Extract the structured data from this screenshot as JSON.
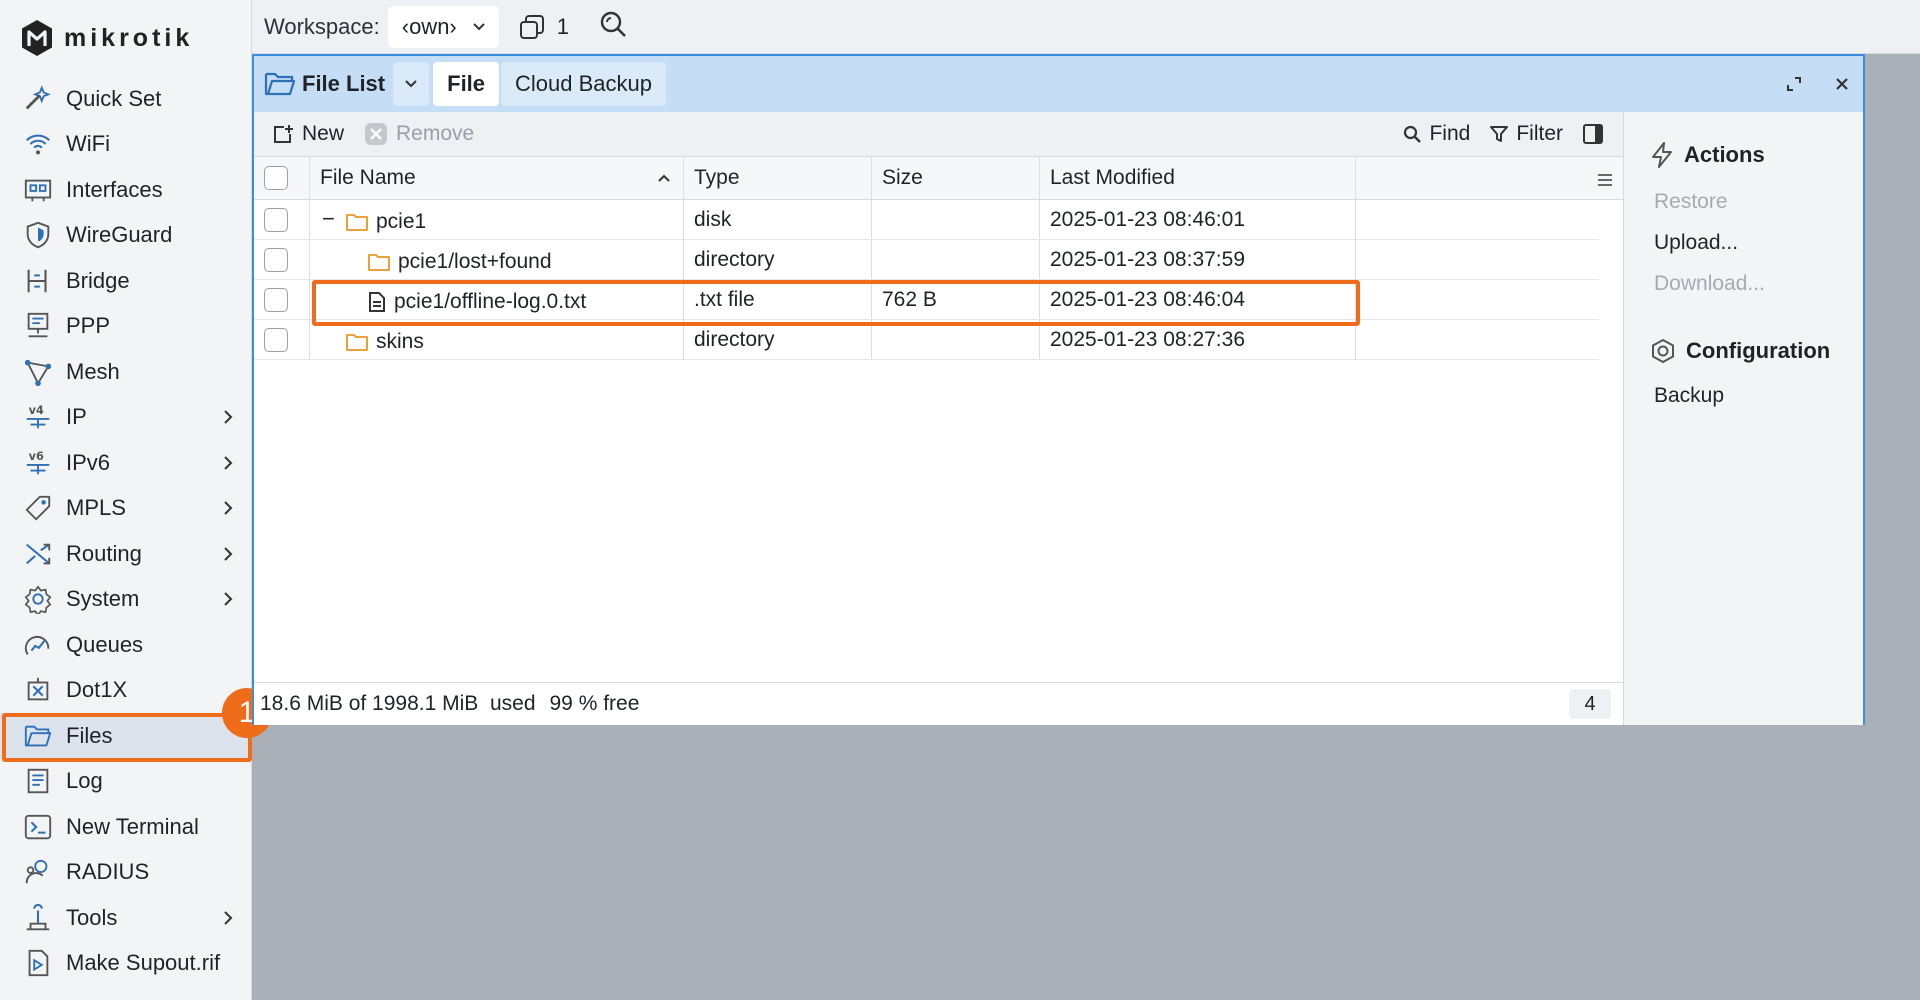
{
  "brand": {
    "name": "MikroTik"
  },
  "sidebar": {
    "items": [
      {
        "label": "Quick Set",
        "icon": "quick-set-icon",
        "has_children": false
      },
      {
        "label": "WiFi",
        "icon": "wifi-icon",
        "has_children": false
      },
      {
        "label": "Interfaces",
        "icon": "interfaces-icon",
        "has_children": false
      },
      {
        "label": "WireGuard",
        "icon": "wireguard-icon",
        "has_children": false
      },
      {
        "label": "Bridge",
        "icon": "bridge-icon",
        "has_children": false
      },
      {
        "label": "PPP",
        "icon": "ppp-icon",
        "has_children": false
      },
      {
        "label": "Mesh",
        "icon": "mesh-icon",
        "has_children": false
      },
      {
        "label": "IP",
        "icon": "ip-icon",
        "has_children": true
      },
      {
        "label": "IPv6",
        "icon": "ipv6-icon",
        "has_children": true
      },
      {
        "label": "MPLS",
        "icon": "mpls-icon",
        "has_children": true
      },
      {
        "label": "Routing",
        "icon": "routing-icon",
        "has_children": true
      },
      {
        "label": "System",
        "icon": "system-icon",
        "has_children": true
      },
      {
        "label": "Queues",
        "icon": "queues-icon",
        "has_children": false
      },
      {
        "label": "Dot1X",
        "icon": "dot1x-icon",
        "has_children": false
      },
      {
        "label": "Files",
        "icon": "files-icon",
        "has_children": false,
        "active": true
      },
      {
        "label": "Log",
        "icon": "log-icon",
        "has_children": false
      },
      {
        "label": "New Terminal",
        "icon": "terminal-icon",
        "has_children": false
      },
      {
        "label": "RADIUS",
        "icon": "radius-icon",
        "has_children": false
      },
      {
        "label": "Tools",
        "icon": "tools-icon",
        "has_children": true
      },
      {
        "label": "Make Supout.rif",
        "icon": "supout-icon",
        "has_children": false
      }
    ],
    "step_badge": "1"
  },
  "topbar": {
    "workspace_label": "Workspace:",
    "workspace_value": "‹own›",
    "window_count": "1"
  },
  "window": {
    "title": "File List",
    "tabs": [
      "File",
      "Cloud Backup"
    ],
    "active_tab": "File",
    "toolbar": {
      "new_label": "New",
      "remove_label": "Remove",
      "find_label": "Find",
      "filter_label": "Filter"
    },
    "columns": [
      "File Name",
      "Type",
      "Size",
      "Last Modified"
    ],
    "rows": [
      {
        "name": "pcie1",
        "type": "disk",
        "size": "",
        "modified": "2025-01-23 08:46:01",
        "kind": "folder",
        "indent": 0,
        "expander": "−"
      },
      {
        "name": "pcie1/lost+found",
        "type": "directory",
        "size": "",
        "modified": "2025-01-23 08:37:59",
        "kind": "folder",
        "indent": 1,
        "expander": ""
      },
      {
        "name": "pcie1/offline-log.0.txt",
        "type": ".txt file",
        "size": "762 B",
        "modified": "2025-01-23 08:46:04",
        "kind": "file",
        "indent": 1,
        "expander": ""
      },
      {
        "name": "skins",
        "type": "directory",
        "size": "",
        "modified": "2025-01-23 08:27:36",
        "kind": "folder",
        "indent": 0,
        "expander": ""
      }
    ],
    "status": {
      "usage_text": "18.6 MiB of 1998.1 MiB  used",
      "free_text": "99 % free",
      "count": "4"
    },
    "side_panel": {
      "actions_title": "Actions",
      "actions": [
        {
          "label": "Restore",
          "enabled": false
        },
        {
          "label": "Upload...",
          "enabled": true
        },
        {
          "label": "Download...",
          "enabled": false
        }
      ],
      "config_title": "Configuration",
      "config_items": [
        {
          "label": "Backup",
          "enabled": true
        }
      ]
    }
  },
  "colors": {
    "accent": "#3b8fe0",
    "title_bar": "#c5def5",
    "highlight": "#ef6c1b",
    "folder": "#e8a23a",
    "icon_blue": "#2f6fb5"
  }
}
